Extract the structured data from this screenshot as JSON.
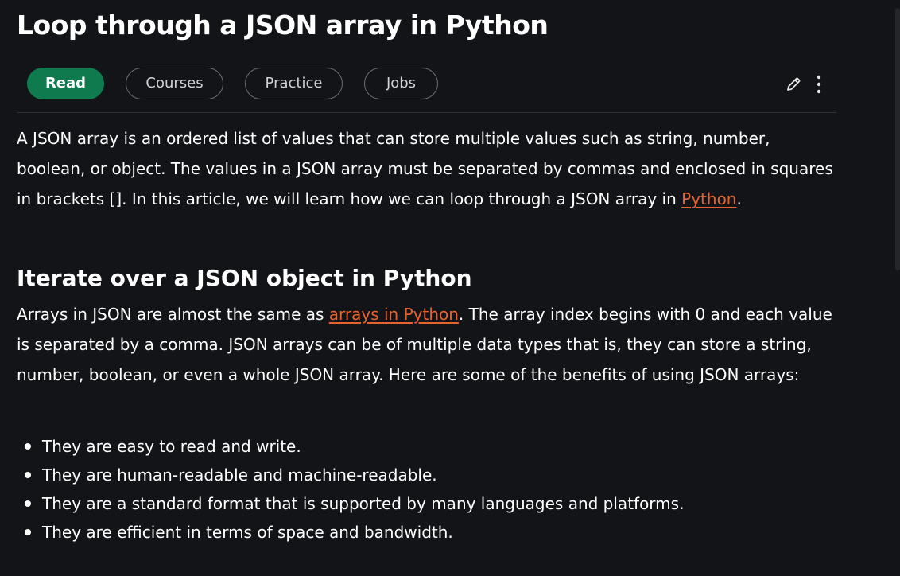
{
  "article": {
    "title": "Loop through a JSON array in Python"
  },
  "tabs": [
    {
      "label": "Read",
      "active": true
    },
    {
      "label": "Courses",
      "active": false
    },
    {
      "label": "Practice",
      "active": false
    },
    {
      "label": "Jobs",
      "active": false
    }
  ],
  "toolbar": {
    "edit_icon": "pencil-icon",
    "more_icon": "vertical-dots-icon"
  },
  "intro": {
    "text_before_link": "A JSON array is an ordered list of values that can store multiple values such as string, number, boolean, or object. The values in a JSON array must be separated by commas and enclosed in squares in brackets []. In this article, we will learn how we can loop through a JSON array in ",
    "link_text": "Python",
    "text_after_link": "."
  },
  "section": {
    "heading": "Iterate over a JSON object in Python",
    "text_before_link": "Arrays in JSON are almost the same as ",
    "link_text": "arrays in Python",
    "text_after_link": ". The array index begins with 0 and each value is separated by a comma. JSON arrays can be of multiple data types that is, they can store a string, number, boolean, or even a whole JSON array. Here are some of the benefits of using JSON arrays:"
  },
  "benefits": [
    "They are easy to read and write.",
    "They are human-readable and machine-readable.",
    "They are a standard format that is supported by many languages and platforms.",
    "They are efficient in terms of space and bandwidth."
  ],
  "colors": {
    "background": "#131417",
    "accent_green": "#0f7a4e",
    "link_orange": "#e8632b",
    "tab_border": "#6b6f76"
  }
}
